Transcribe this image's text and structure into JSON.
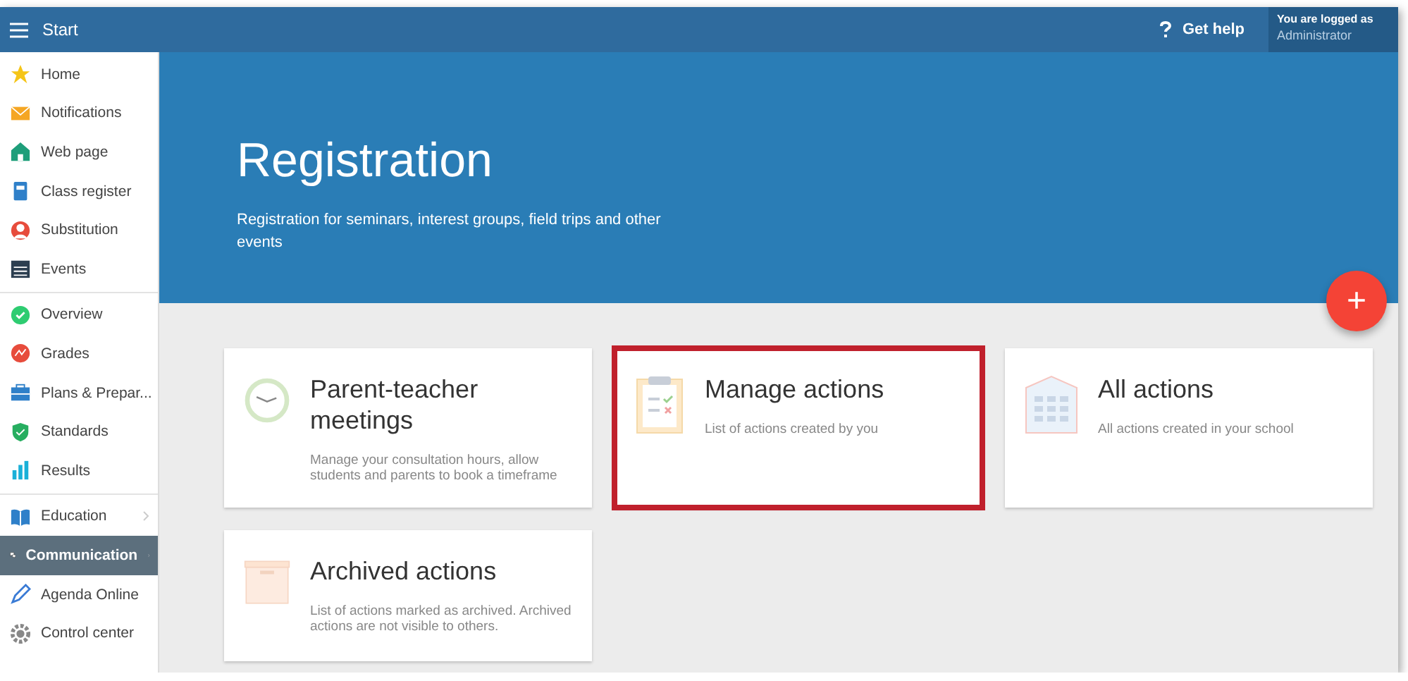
{
  "topbar": {
    "title": "Start",
    "help": "Get help",
    "login_label": "You are logged as",
    "login_user": "Administrator"
  },
  "sidebar": {
    "groups": [
      [
        {
          "label": "Home",
          "selected": false
        },
        {
          "label": "Notifications",
          "selected": false
        },
        {
          "label": "Web page",
          "selected": false
        },
        {
          "label": "Class register",
          "selected": false
        },
        {
          "label": "Substitution",
          "selected": false
        },
        {
          "label": "Events",
          "selected": false
        }
      ],
      [
        {
          "label": "Overview",
          "selected": false
        },
        {
          "label": "Grades",
          "selected": false
        },
        {
          "label": "Plans & Prepar...",
          "selected": false
        },
        {
          "label": "Standards",
          "selected": false
        },
        {
          "label": "Results",
          "selected": false
        }
      ],
      [
        {
          "label": "Education",
          "selected": false,
          "expandable": true
        },
        {
          "label": "Communication",
          "selected": true,
          "expandable": true
        },
        {
          "label": "Agenda Online",
          "selected": false
        },
        {
          "label": "Control center",
          "selected": false
        }
      ]
    ]
  },
  "banner": {
    "title": "Registration",
    "subtitle": "Registration for seminars, interest groups, field trips and other events"
  },
  "fab": "+",
  "cards": [
    {
      "title": "Parent-teacher meetings",
      "description": "Manage your consultation hours, allow students and parents to book a timeframe",
      "highlighted": false
    },
    {
      "title": "Manage actions",
      "description": "List of actions created by you",
      "highlighted": true
    },
    {
      "title": "All actions",
      "description": "All actions created in your school",
      "highlighted": false
    },
    {
      "title": "Archived actions",
      "description": "List of actions marked as archived. Archived actions are not visible to others.",
      "highlighted": false
    }
  ]
}
